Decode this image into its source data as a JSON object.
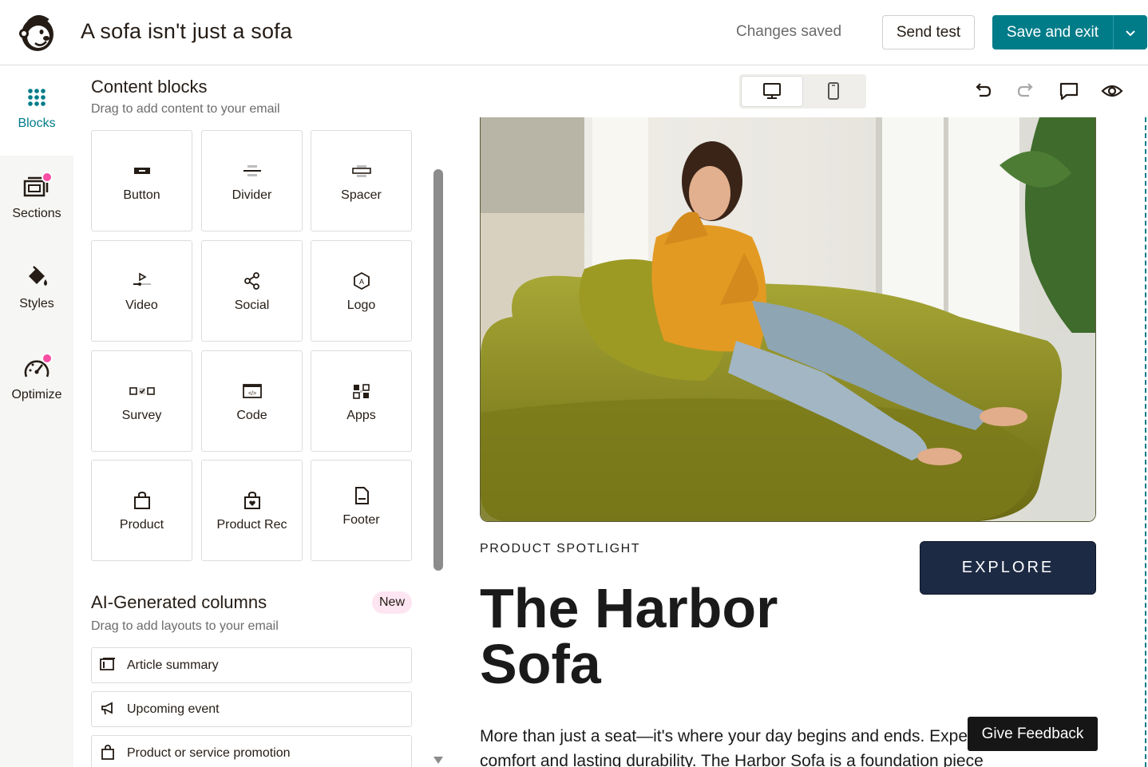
{
  "header": {
    "title": "A sofa isn't just a sofa",
    "status": "Changes saved",
    "send_test_label": "Send test",
    "save_exit_label": "Save and exit"
  },
  "rail": {
    "items": [
      {
        "label": "Blocks",
        "icon": "grid-dots-icon",
        "active": true
      },
      {
        "label": "Sections",
        "icon": "sections-icon",
        "badge": true
      },
      {
        "label": "Styles",
        "icon": "paint-bucket-icon"
      },
      {
        "label": "Optimize",
        "icon": "gauge-icon",
        "badge": true
      }
    ]
  },
  "panel": {
    "title": "Content blocks",
    "subtitle": "Drag to add content to your email",
    "blocks": [
      {
        "label": "Button",
        "icon": "button-icon"
      },
      {
        "label": "Divider",
        "icon": "divider-icon"
      },
      {
        "label": "Spacer",
        "icon": "spacer-icon"
      },
      {
        "label": "Video",
        "icon": "video-icon"
      },
      {
        "label": "Social",
        "icon": "share-icon"
      },
      {
        "label": "Logo",
        "icon": "logo-hexagon-icon"
      },
      {
        "label": "Survey",
        "icon": "survey-icon"
      },
      {
        "label": "Code",
        "icon": "code-icon"
      },
      {
        "label": "Apps",
        "icon": "apps-icon"
      },
      {
        "label": "Product",
        "icon": "shopping-bag-icon"
      },
      {
        "label": "Product Rec",
        "icon": "product-rec-icon"
      },
      {
        "label": "Footer",
        "icon": "footer-doc-icon"
      }
    ],
    "ai": {
      "title": "AI-Generated columns",
      "badge": "New",
      "subtitle": "Drag to add layouts to your email",
      "rows": [
        {
          "label": "Article summary",
          "icon": "article-icon"
        },
        {
          "label": "Upcoming event",
          "icon": "megaphone-icon"
        },
        {
          "label": "Product or service promotion",
          "icon": "shopping-bag-icon"
        }
      ]
    }
  },
  "toolbar": {
    "devices": [
      "desktop-icon",
      "mobile-icon"
    ],
    "tools": [
      "undo-icon",
      "redo-icon",
      "comment-icon",
      "preview-eye-icon"
    ]
  },
  "email": {
    "eyebrow": "PRODUCT SPOTLIGHT",
    "cta": "EXPLORE",
    "product_name": "The Harbor Sofa",
    "body": "More than just a seat—it's where your day begins and ends. Experience deep comfort and lasting durability. The Harbor Sofa is a foundation piece"
  },
  "feedback_label": "Give Feedback",
  "colors": {
    "brand_teal": "#007c89",
    "badge_pink": "#f74ea3",
    "cta_navy": "#1d2a44"
  }
}
